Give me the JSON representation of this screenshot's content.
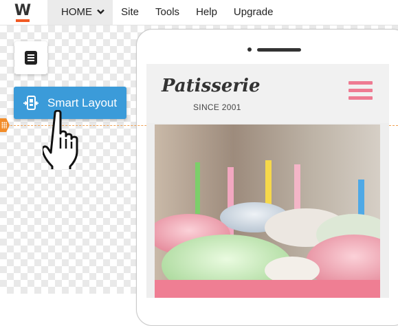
{
  "logo": {
    "letter": "W",
    "accent": "#f15a24"
  },
  "nav": {
    "home": "HOME",
    "site": "Site",
    "tools": "Tools",
    "help": "Help",
    "upgrade": "Upgrade"
  },
  "sidebar": {
    "menu_icon": "document-icon",
    "smart_layout_label": "Smart Layout",
    "smart_layout_icon": "smart-layout-icon"
  },
  "preview": {
    "title": "Patisserie",
    "tagline": "SINCE 2001",
    "menu_icon": "hamburger-icon"
  },
  "colors": {
    "accent_blue": "#3b9bd9",
    "accent_orange": "#f28c28",
    "brand_pink": "#ef7e93"
  }
}
